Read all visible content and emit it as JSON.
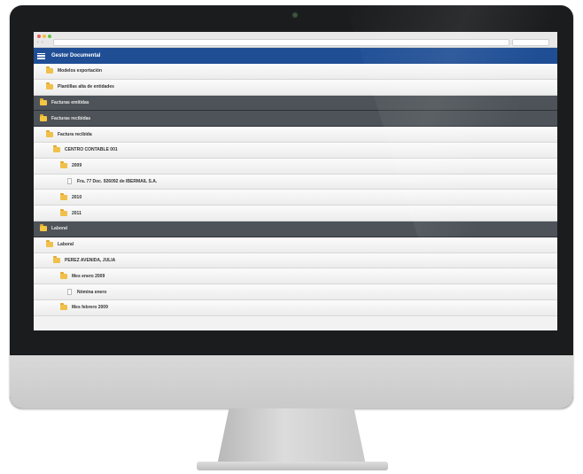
{
  "app": {
    "title": "Gestor Documental"
  },
  "colors": {
    "header": "#1f4e95",
    "section": "#4d5358",
    "folder": "#f0c04a",
    "traffic": [
      "#ee5b55",
      "#f4be3a",
      "#5fc546"
    ]
  },
  "tree": {
    "items": [
      {
        "label": "Modelos exportación",
        "type": "folder"
      },
      {
        "label": "Plantillas alta de entidades",
        "type": "folder"
      },
      {
        "label": "Facturas emitidas",
        "type": "section"
      },
      {
        "label": "Facturas recibidas",
        "type": "section"
      },
      {
        "label": "Factura recibida",
        "type": "folder"
      },
      {
        "label": "CENTRO CONTABLE 001",
        "type": "folder"
      },
      {
        "label": "2009",
        "type": "folder"
      },
      {
        "label": "Fra. 77 Doc. 926092 de IBERMAIL S.A.",
        "type": "document"
      },
      {
        "label": "2010",
        "type": "folder"
      },
      {
        "label": "2011",
        "type": "folder"
      },
      {
        "label": "Laboral",
        "type": "section"
      },
      {
        "label": "Laboral",
        "type": "folder"
      },
      {
        "label": "PEREZ AVENIDA, JULIA",
        "type": "folder"
      },
      {
        "label": "Mes enero 2009",
        "type": "folder"
      },
      {
        "label": "Nómina enero",
        "type": "document"
      },
      {
        "label": "Mes febrero 2009",
        "type": "folder"
      }
    ]
  }
}
